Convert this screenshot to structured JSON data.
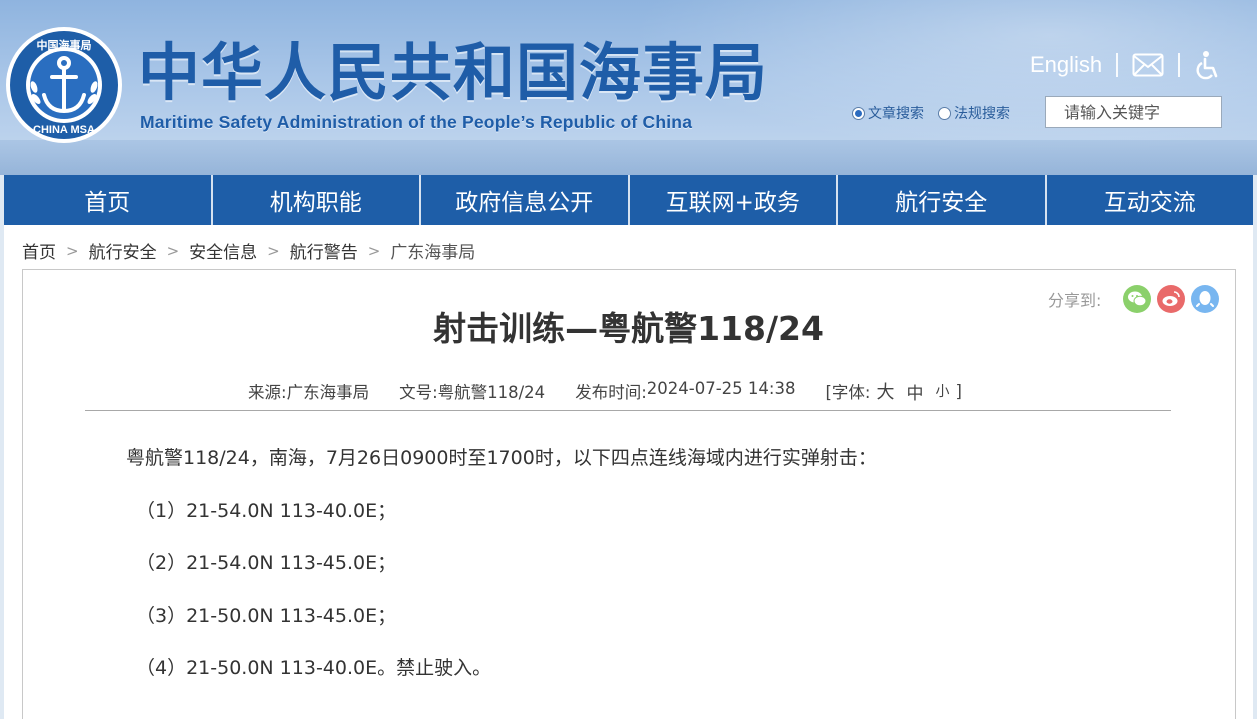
{
  "header": {
    "title_cn": "中华人民共和国海事局",
    "title_en": "Maritime Safety Administration of the People’s Republic of China",
    "logo_text_top": "中国海事局",
    "logo_text_bottom": "CHINA MSA",
    "english_link": "English",
    "mail_icon": "mail-icon",
    "accessibility_icon": "accessibility-icon",
    "search": {
      "options": [
        {
          "label": "文章搜索",
          "checked": true
        },
        {
          "label": "法规搜索",
          "checked": false
        }
      ],
      "placeholder": "请输入关键字"
    }
  },
  "nav": {
    "items": [
      "首页",
      "机构职能",
      "政府信息公开",
      "互联网+政务",
      "航行安全",
      "互动交流"
    ]
  },
  "breadcrumb": {
    "items": [
      "首页",
      "航行安全",
      "安全信息",
      "航行警告",
      "广东海事局"
    ],
    "separator": ">"
  },
  "share": {
    "label": "分享到:",
    "buttons": [
      "wechat",
      "weibo",
      "qq"
    ]
  },
  "article": {
    "title": "射击训练—粤航警118/24",
    "meta": {
      "source_label": "来源:",
      "source": "广东海事局",
      "doc_label": "文号:",
      "doc_no": "粤航警118/24",
      "time_label": "发布时间:",
      "time": "2024-07-25 14:38",
      "font_label": "[字体:",
      "font_big": "大",
      "font_mid": "中",
      "font_small": "小",
      "font_close": "]"
    },
    "body": [
      "粤航警118/24，南海，7月26日0900时至1700时，以下四点连线海域内进行实弹射击：",
      "（1）21-54.0N 113-40.0E；",
      "（2）21-54.0N 113-45.0E；",
      "（3）21-50.0N 113-45.0E；",
      "（4）21-50.0N 113-40.0E。禁止驶入。"
    ]
  },
  "colors": {
    "brand_blue": "#1e5ea8",
    "title_blue": "#1f5da8",
    "wechat": "#8bd06b",
    "weibo": "#e96a6a",
    "qq": "#78b6f0"
  }
}
